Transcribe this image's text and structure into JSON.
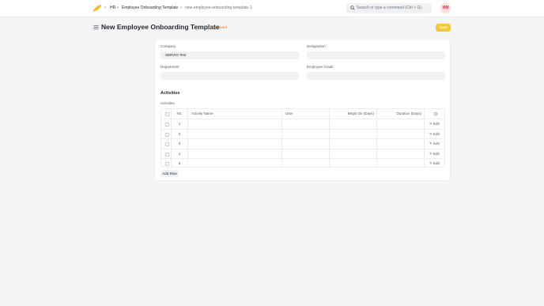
{
  "navbar": {
    "breadcrumbs": [
      "HR",
      "Employee Onboarding Template",
      "new-employee-onboarding-template-1"
    ],
    "search_placeholder": "Search or type a command (Ctrl + G)",
    "avatar_initials": "HM"
  },
  "page": {
    "title": "New Employee Onboarding Template",
    "status": "• Not Saved",
    "save_label": "Save"
  },
  "form": {
    "company_label": "Company",
    "company_value": "SERVIO Test",
    "designation_label": "Designation",
    "designation_value": "",
    "department_label": "Department",
    "department_value": "",
    "employee_grade_label": "Employee Grade",
    "employee_grade_value": ""
  },
  "activities": {
    "section_title": "Activities",
    "table_label": "Activities",
    "columns": [
      "No.",
      "Activity Name",
      "User",
      "Begin On (Days)",
      "Duration (Days)"
    ],
    "rows": [
      {
        "no": "1",
        "edit": "Edit"
      },
      {
        "no": "2",
        "edit": "Edit"
      },
      {
        "no": "3",
        "edit": "Edit"
      },
      {
        "no": "4",
        "edit": "Edit"
      },
      {
        "no": "5",
        "edit": "Edit"
      }
    ],
    "add_row_label": "Add Row"
  },
  "colors": {
    "save_button": "#f5c836",
    "not_saved": "#e86c13",
    "avatar_bg": "#fbdfe1",
    "avatar_text": "#c0353e"
  }
}
